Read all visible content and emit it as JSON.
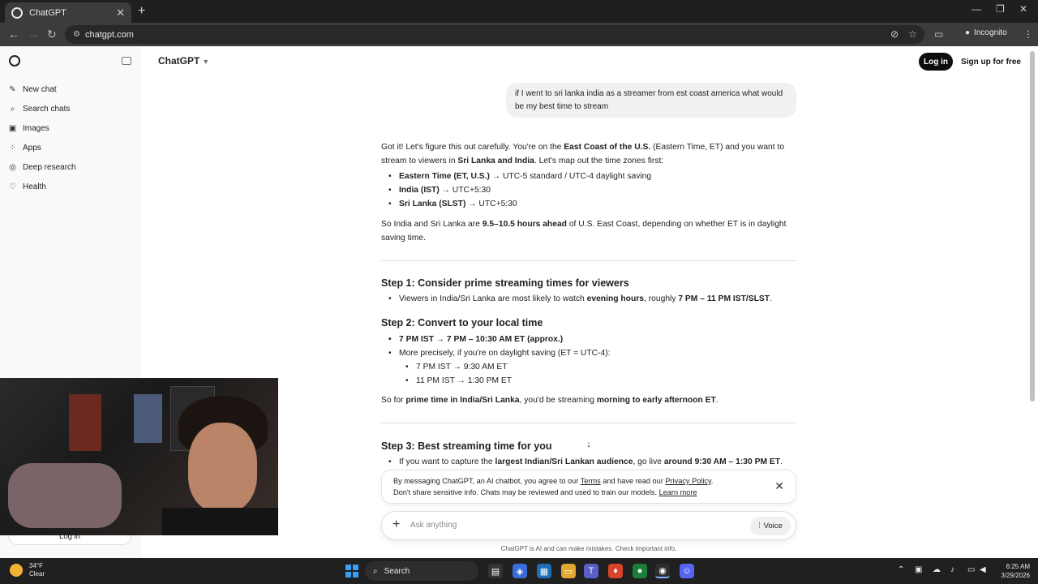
{
  "browser": {
    "tab_title": "ChatGPT",
    "tab_close": "✕",
    "new_tab": "+",
    "url": "chatgpt.com",
    "incognito_label": "Incognito",
    "window_controls": [
      "—",
      "❐",
      "✕"
    ]
  },
  "sidebar": {
    "items": [
      {
        "label": "New chat",
        "icon": "✎"
      },
      {
        "label": "Search chats",
        "icon": "⌕"
      },
      {
        "label": "Images",
        "icon": "▣"
      },
      {
        "label": "Apps",
        "icon": "⁘"
      },
      {
        "label": "Deep research",
        "icon": "◎"
      },
      {
        "label": "Health",
        "icon": "♡"
      }
    ]
  },
  "header": {
    "title": "ChatGPT",
    "login_label": "Log in",
    "signup_label": "Sign up for free"
  },
  "conversation": {
    "user_message": "if I went to sri lanka india as a streamer from est coast america what would be my best time to stream",
    "intro_1": "Got it! Let's figure this out carefully. You're on the ",
    "intro_b1": "East Coast of the U.S.",
    "intro_2": " (Eastern Time, ET) and you want to stream to viewers in ",
    "intro_b2": "Sri Lanka and India",
    "intro_3": ". Let's map out the time zones first:",
    "zones": [
      {
        "bold": "Eastern Time (ET, U.S.)",
        "rest": " → UTC-5 standard / UTC-4 daylight saving"
      },
      {
        "bold": "India (IST)",
        "rest": " → UTC+5:30"
      },
      {
        "bold": "Sri Lanka (SLST)",
        "rest": " → UTC+5:30"
      }
    ],
    "ahead_1": "So India and Sri Lanka are ",
    "ahead_b": "9.5–10.5 hours ahead",
    "ahead_2": " of U.S. East Coast, depending on whether ET is in daylight saving time.",
    "step1_title": "Step 1: Consider prime streaming times for viewers",
    "step1_a": "Viewers in India/Sri Lanka are most likely to watch ",
    "step1_b1": "evening hours",
    "step1_c": ", roughly ",
    "step1_b2": "7 PM – 11 PM IST/SLST",
    "step1_d": ".",
    "step2_title": "Step 2: Convert to your local time",
    "step2_item1": "7 PM IST → 7 PM – 10:30 AM ET (approx.)",
    "step2_item2": "More precisely, if you're on daylight saving (ET = UTC-4):",
    "step2_sub1": "7 PM IST → 9:30 AM ET",
    "step2_sub2": "11 PM IST → 1:30 PM ET",
    "step2_sum_a": "So for ",
    "step2_sum_b1": "prime time in India/Sri Lanka",
    "step2_sum_c": ", you'd be streaming ",
    "step2_sum_b2": "morning to early afternoon ET",
    "step2_sum_d": ".",
    "step3_title": "Step 3: Best streaming time for you",
    "step3_a": "If you want to capture the ",
    "step3_b1": "largest Indian/Sri Lankan audience",
    "step3_c": ", go live ",
    "step3_b2": "around 9:30 AM – 1:30 PM ET",
    "step3_d": "."
  },
  "consent": {
    "line1_a": "By messaging ChatGPT, an AI chatbot, you agree to our ",
    "terms": "Terms",
    "line1_b": " and have read our ",
    "privacy": "Privacy Policy",
    "line1_c": ".",
    "line2": "Don't share sensitive info. Chats may be reviewed and used to train our models. ",
    "learn_more": "Learn more"
  },
  "composer": {
    "placeholder": "Ask anything",
    "voice_label": "Voice",
    "footnote": "ChatGPT is AI and can make mistakes. Check important info."
  },
  "webcam": {
    "login_label": "Log in"
  },
  "taskbar": {
    "temp": "34°F",
    "condition": "Clear",
    "search_label": "Search",
    "time": "6:25 AM",
    "date": "3/29/2026"
  }
}
